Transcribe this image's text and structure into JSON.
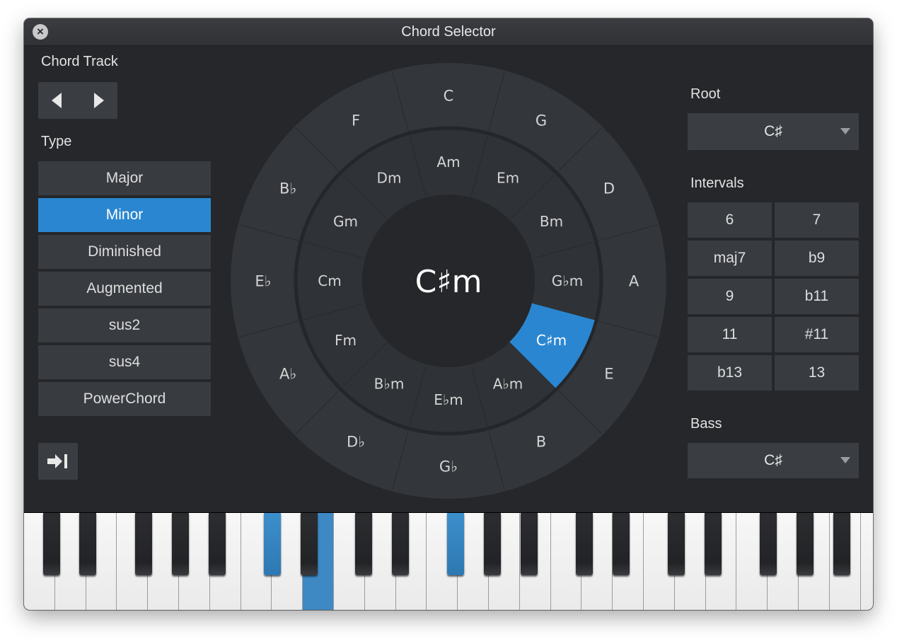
{
  "window": {
    "title": "Chord Selector",
    "close_label": "×"
  },
  "left": {
    "chord_track_label": "Chord Track",
    "type_label": "Type",
    "types": [
      {
        "label": "Major",
        "active": false
      },
      {
        "label": "Minor",
        "active": true
      },
      {
        "label": "Diminished",
        "active": false
      },
      {
        "label": "Augmented",
        "active": false
      },
      {
        "label": "sus2",
        "active": false
      },
      {
        "label": "sus4",
        "active": false
      },
      {
        "label": "PowerChord",
        "active": false
      }
    ]
  },
  "wheel": {
    "center_label": "C♯m",
    "outer": [
      "C",
      "G",
      "D",
      "A",
      "E",
      "B",
      "G♭",
      "D♭",
      "A♭",
      "E♭",
      "B♭",
      "F"
    ],
    "inner": [
      "Am",
      "Em",
      "Bm",
      "G♭m",
      "C♯m",
      "A♭m",
      "E♭m",
      "B♭m",
      "Fm",
      "Cm",
      "Gm",
      "Dm"
    ],
    "selected_inner_index": 4,
    "accent_color": "#2a86d0"
  },
  "right": {
    "root_label": "Root",
    "root_value": "C♯",
    "intervals_label": "Intervals",
    "intervals": [
      "6",
      "7",
      "maj7",
      "b9",
      "9",
      "b11",
      "11",
      "#11",
      "b13",
      "13"
    ],
    "bass_label": "Bass",
    "bass_value": "C♯"
  },
  "keyboard": {
    "highlight_color": "#3e88c4",
    "active_white_keys": [
      9
    ],
    "active_black_keys": [
      5,
      9
    ]
  }
}
